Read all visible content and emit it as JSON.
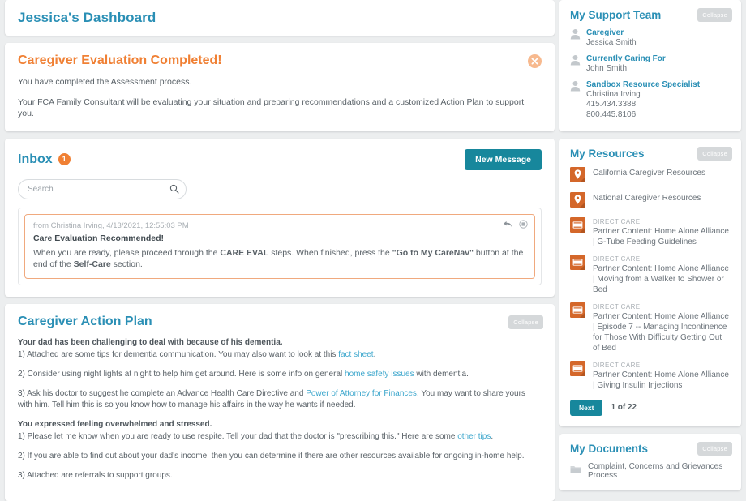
{
  "header": {
    "title": "Jessica's Dashboard"
  },
  "alert": {
    "title": "Caregiver Evaluation Completed!",
    "line1": "You have completed the Assessment process.",
    "line2": "Your FCA Family Consultant will be evaluating your situation and preparing recommendations and a customized Action Plan to support you.",
    "close_icon": "close-circle-icon"
  },
  "inbox": {
    "title": "Inbox",
    "unread_count": "1",
    "new_message_label": "New Message",
    "search_placeholder": "Search",
    "search_value": "",
    "search_icon": "search-icon",
    "message": {
      "meta": "from Christina Irving, 4/13/2021, 12:55:03 PM",
      "subject": "Care Evaluation Recommended!",
      "body_1": "When you are ready, please proceed through the ",
      "body_bold_1": "CARE EVAL",
      "body_2": " steps. When finished, press the ",
      "body_bold_2": "\"Go to My CareNav\"",
      "body_3": " button at the end of the ",
      "body_bold_3": "Self-Care",
      "body_4": " section.",
      "reply_icon": "reply-arrow-icon",
      "delete_icon": "delete-circle-icon"
    }
  },
  "action_plan": {
    "title": "Caregiver Action Plan",
    "collapse_label": "Collapse",
    "section_1_header": "Your dad has been challenging to deal with because of his dementia.",
    "s1_item1_a": "1) Attached are some tips for dementia communication. You may also want to look at this ",
    "s1_item1_link": "fact sheet",
    "s1_item1_b": ".",
    "s1_item2_a": "2) Consider using night lights at night to help him get around. Here is some info on general ",
    "s1_item2_link": "home safety issues",
    "s1_item2_b": " with dementia.",
    "s1_item3_a": "3) Ask his doctor to suggest he complete an Advance Health Care Directive and ",
    "s1_item3_link": "Power of Attorney for Finances",
    "s1_item3_b": ". You may want to share yours with him. Tell him this is so you know how to manage his affairs in the way he wants if needed.",
    "section_2_header": "You expressed feeling overwhelmed and stressed.",
    "s2_item1_a": "1) Please let me know when you are ready to use respite. Tell your dad that the doctor is \"prescribing this.\" Here are some ",
    "s2_item1_link": "other tips",
    "s2_item1_b": ".",
    "s2_item2": "2) If you are able to find out about your dad's income, then you can determine if there are other resources available for ongoing in-home help.",
    "s2_item3": "3) Attached are referrals to support groups."
  },
  "support_team": {
    "title": "My Support Team",
    "collapse_label": "Collapse",
    "members": [
      {
        "icon": "person-icon",
        "role": "Caregiver",
        "name": "Jessica Smith",
        "phone1": "",
        "phone2": ""
      },
      {
        "icon": "person-icon",
        "role": "Currently Caring For",
        "name": "John Smith",
        "phone1": "",
        "phone2": ""
      },
      {
        "icon": "person-icon",
        "role": "Sandbox Resource Specialist",
        "name": "Christina Irving",
        "phone1": "415.434.3388",
        "phone2": "800.445.8106"
      }
    ]
  },
  "resources": {
    "title": "My Resources",
    "collapse_label": "Collapse",
    "items": [
      {
        "icon": "map-pin-icon",
        "kicker": "",
        "label": "California Caregiver Resources"
      },
      {
        "icon": "map-pin-icon",
        "kicker": "",
        "label": "National Caregiver Resources"
      },
      {
        "icon": "video-icon",
        "kicker": "DIRECT CARE",
        "label": "Partner Content: Home Alone Alliance | G-Tube Feeding Guidelines"
      },
      {
        "icon": "video-icon",
        "kicker": "DIRECT CARE",
        "label": "Partner Content: Home Alone Alliance | Moving from a Walker to Shower or Bed"
      },
      {
        "icon": "video-icon",
        "kicker": "DIRECT CARE",
        "label": "Partner Content: Home Alone Alliance | Episode 7 -- Managing Incontinence for Those With Difficulty Getting Out of Bed"
      },
      {
        "icon": "video-icon",
        "kicker": "DIRECT CARE",
        "label": "Partner Content: Home Alone Alliance | Giving Insulin Injections"
      }
    ],
    "next_label": "Next",
    "pager_label": "1 of 22"
  },
  "documents": {
    "title": "My Documents",
    "collapse_label": "Collapse",
    "items": [
      {
        "icon": "document-icon",
        "label": "Complaint, Concerns and Grievances Process"
      }
    ]
  },
  "colors": {
    "brand_blue": "#2a8fb5",
    "accent_orange": "#f08034",
    "teal_button": "#17879c",
    "link_blue": "#3ba6cc",
    "page_bg": "#eceeef"
  }
}
